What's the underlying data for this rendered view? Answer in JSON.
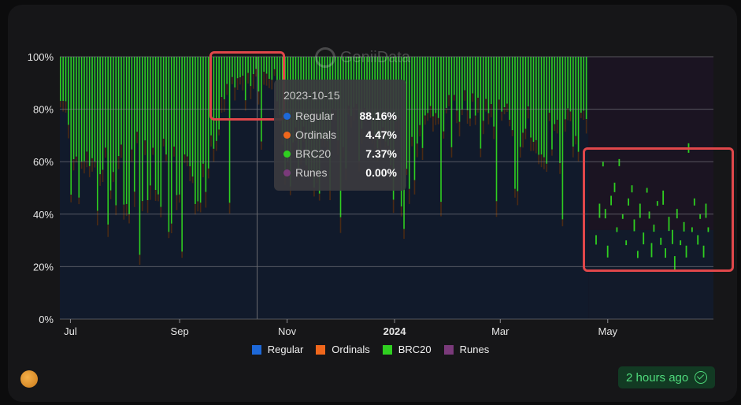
{
  "chart_data": {
    "type": "area",
    "stacked": true,
    "normalized": true,
    "y_unit": "%",
    "ylim": [
      0,
      100
    ],
    "yticks": [
      "0%",
      "20%",
      "40%",
      "60%",
      "80%",
      "100%"
    ],
    "xticks": [
      "Jul",
      "Sep",
      "Nov",
      "2024",
      "Mar",
      "May"
    ],
    "xticks_bold": [
      "2024"
    ],
    "x_range": [
      "2023-06-25",
      "2024-06-30"
    ],
    "grid": true,
    "legend_position": "bottom",
    "series": [
      {
        "name": "Regular",
        "color": "#1d68d8"
      },
      {
        "name": "Ordinals",
        "color": "#f0671c"
      },
      {
        "name": "BRC20",
        "color": "#2fcf20"
      },
      {
        "name": "Runes",
        "color": "#7a3a7a"
      }
    ],
    "brc20_share_points": [
      {
        "x": "2023-06-25",
        "brc20": 20,
        "low": 8
      },
      {
        "x": "2023-07-05",
        "brc20": 48,
        "low": 28
      },
      {
        "x": "2023-07-20",
        "brc20": 55,
        "low": 30
      },
      {
        "x": "2023-08-05",
        "brc20": 52,
        "low": 28
      },
      {
        "x": "2023-08-20",
        "brc20": 50,
        "low": 30
      },
      {
        "x": "2023-09-05",
        "brc20": 55,
        "low": 38
      },
      {
        "x": "2023-09-18",
        "brc20": 45,
        "low": 32
      },
      {
        "x": "2023-09-25",
        "brc20": 18,
        "low": 4
      },
      {
        "x": "2023-10-05",
        "brc20": 10,
        "low": 2
      },
      {
        "x": "2023-10-15",
        "brc20": 7.37,
        "low": 1
      },
      {
        "x": "2023-10-25",
        "brc20": 8,
        "low": 2
      },
      {
        "x": "2023-10-29",
        "brc20": 45,
        "low": 20
      },
      {
        "x": "2023-11-10",
        "brc20": 42,
        "low": 25
      },
      {
        "x": "2023-11-25",
        "brc20": 35,
        "low": 20
      },
      {
        "x": "2023-12-10",
        "brc20": 30,
        "low": 18
      },
      {
        "x": "2023-12-28",
        "brc20": 40,
        "low": 22
      },
      {
        "x": "2024-01-10",
        "brc20": 45,
        "low": 20
      },
      {
        "x": "2024-01-25",
        "brc20": 30,
        "low": 12
      },
      {
        "x": "2024-02-10",
        "brc20": 20,
        "low": 8
      },
      {
        "x": "2024-02-25",
        "brc20": 25,
        "low": 10
      },
      {
        "x": "2024-03-10",
        "brc20": 30,
        "low": 10
      },
      {
        "x": "2024-03-25",
        "brc20": 35,
        "low": 18
      },
      {
        "x": "2024-04-05",
        "brc20": 40,
        "low": 22
      },
      {
        "x": "2024-04-12",
        "brc20": 30,
        "low": 10
      }
    ],
    "runes_scatter_brc20_levels": [
      [
        0.02,
        32
      ],
      [
        0.05,
        44
      ],
      [
        0.08,
        60
      ],
      [
        0.1,
        42
      ],
      [
        0.12,
        28
      ],
      [
        0.15,
        47
      ],
      [
        0.18,
        52
      ],
      [
        0.2,
        35
      ],
      [
        0.22,
        61
      ],
      [
        0.25,
        40
      ],
      [
        0.28,
        30
      ],
      [
        0.3,
        46
      ],
      [
        0.33,
        51
      ],
      [
        0.35,
        38
      ],
      [
        0.38,
        26
      ],
      [
        0.4,
        44
      ],
      [
        0.43,
        33
      ],
      [
        0.46,
        50
      ],
      [
        0.48,
        41
      ],
      [
        0.5,
        29
      ],
      [
        0.52,
        36
      ],
      [
        0.55,
        45
      ],
      [
        0.58,
        31
      ],
      [
        0.6,
        49
      ],
      [
        0.62,
        27
      ],
      [
        0.65,
        39
      ],
      [
        0.68,
        34
      ],
      [
        0.7,
        24
      ],
      [
        0.72,
        42
      ],
      [
        0.75,
        30
      ],
      [
        0.78,
        37
      ],
      [
        0.8,
        28
      ],
      [
        0.82,
        67
      ],
      [
        0.85,
        35
      ],
      [
        0.87,
        46
      ],
      [
        0.9,
        32
      ],
      [
        0.92,
        40
      ],
      [
        0.95,
        28
      ],
      [
        0.97,
        44
      ],
      [
        0.99,
        35
      ]
    ],
    "tooltip": {
      "date": "2023-10-15",
      "rows": [
        {
          "name": "Regular",
          "value": "88.16%",
          "color": "#1d68d8"
        },
        {
          "name": "Ordinals",
          "value": "4.47%",
          "color": "#f0671c"
        },
        {
          "name": "BRC20",
          "value": "7.37%",
          "color": "#2fcf20"
        },
        {
          "name": "Runes",
          "value": "0.00%",
          "color": "#7a3a7a"
        }
      ]
    }
  },
  "watermark": "GeniiData",
  "status_badge": "2 hours ago"
}
